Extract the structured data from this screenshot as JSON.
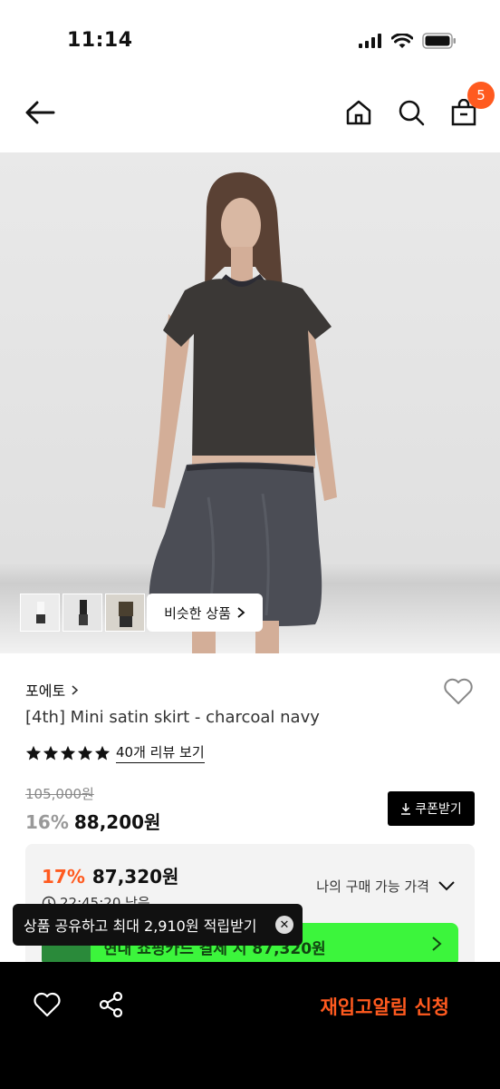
{
  "status_bar": {
    "time": "11:14"
  },
  "nav": {
    "cart_count": "5"
  },
  "gallery": {
    "similar_label": "비슷한 상품"
  },
  "product": {
    "brand": "포에토",
    "title": "[4th] Mini satin skirt - charcoal navy",
    "rating_stars": 5,
    "review_link": "40개 리뷰 보기",
    "original_price": "105,000원",
    "discount": "16%",
    "price": "88,200원",
    "coupon_label": "쿠폰받기"
  },
  "benefit": {
    "discount": "17%",
    "price": "87,320원",
    "label": "나의 구매 가능 가격",
    "timer": "22:45:20 남음",
    "banner_text": "현대 쇼핑카드 결제 시 87,320원"
  },
  "toast": {
    "text": "상품 공유하고 최대 2,910원 적립받기",
    "close": "✕"
  },
  "bottom_bar": {
    "cta": "재입고알림 신청"
  },
  "colors": {
    "accent": "#ff5a1f",
    "green_banner": "#3cf53c"
  }
}
